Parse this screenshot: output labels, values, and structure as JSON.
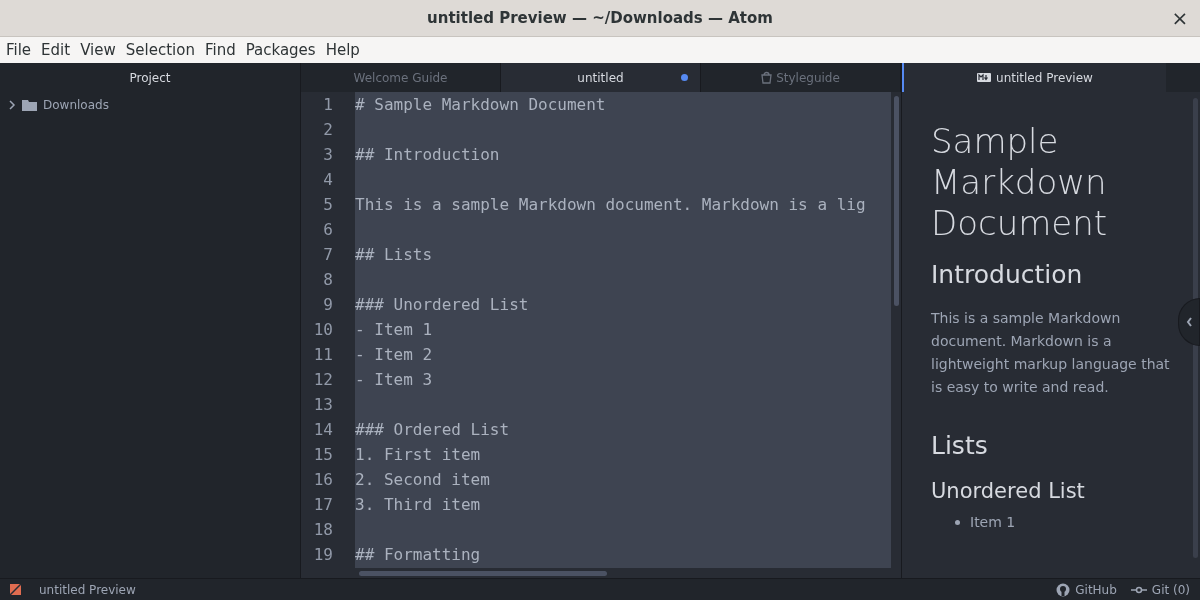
{
  "window": {
    "title": "untitled Preview — ~/Downloads — Atom",
    "close": "×"
  },
  "menu": [
    "File",
    "Edit",
    "View",
    "Selection",
    "Find",
    "Packages",
    "Help"
  ],
  "project": {
    "title": "Project",
    "tree": [
      {
        "label": "Downloads",
        "expanded": false
      }
    ]
  },
  "editor_tabs": [
    {
      "label": "Welcome Guide",
      "selected": false,
      "modified": false,
      "kind": "plain"
    },
    {
      "label": "untitled",
      "selected": true,
      "modified": true,
      "kind": "plain"
    },
    {
      "label": "Styleguide",
      "selected": false,
      "modified": false,
      "kind": "styleguide"
    }
  ],
  "editor": {
    "all_selected": true,
    "lines": [
      {
        "number": "1",
        "text": "# Sample Markdown Document"
      },
      {
        "number": "2"
      },
      {
        "number": "3",
        "text": "## Introduction"
      },
      {
        "number": "4"
      },
      {
        "number": "5",
        "text": "This is a sample Markdown document. Markdown is a lig"
      },
      {
        "number": "6"
      },
      {
        "number": "7",
        "text": "## Lists"
      },
      {
        "number": "8"
      },
      {
        "number": "9",
        "text": "### Unordered List"
      },
      {
        "number": "10",
        "text": "- Item 1"
      },
      {
        "number": "11",
        "text": "- Item 2"
      },
      {
        "number": "12",
        "text": "- Item 3"
      },
      {
        "number": "13"
      },
      {
        "number": "14",
        "text": "### Ordered List"
      },
      {
        "number": "15",
        "text": "1. First item"
      },
      {
        "number": "16",
        "text": "2. Second item"
      },
      {
        "number": "17",
        "text": "3. Third item"
      },
      {
        "number": "18"
      },
      {
        "number": "19",
        "text": "## Formatting"
      }
    ]
  },
  "preview_tabs": [
    {
      "label": "untitled Preview",
      "selected": true
    }
  ],
  "preview": {
    "blocks": [
      {
        "kind": "h1",
        "text": "Sample Markdown Document"
      },
      {
        "kind": "h2",
        "text": "Introduction"
      },
      {
        "kind": "p",
        "text": "This is a sample Markdown document. Markdown is a lightweight markup language that is easy to write and read."
      },
      {
        "kind": "h2",
        "text": "Lists"
      },
      {
        "kind": "h3",
        "text": "Unordered List"
      },
      {
        "kind": "li",
        "text": "Item 1"
      }
    ]
  },
  "status_bar": {
    "file": "untitled Preview",
    "github": "GitHub",
    "git": "Git (0)"
  }
}
